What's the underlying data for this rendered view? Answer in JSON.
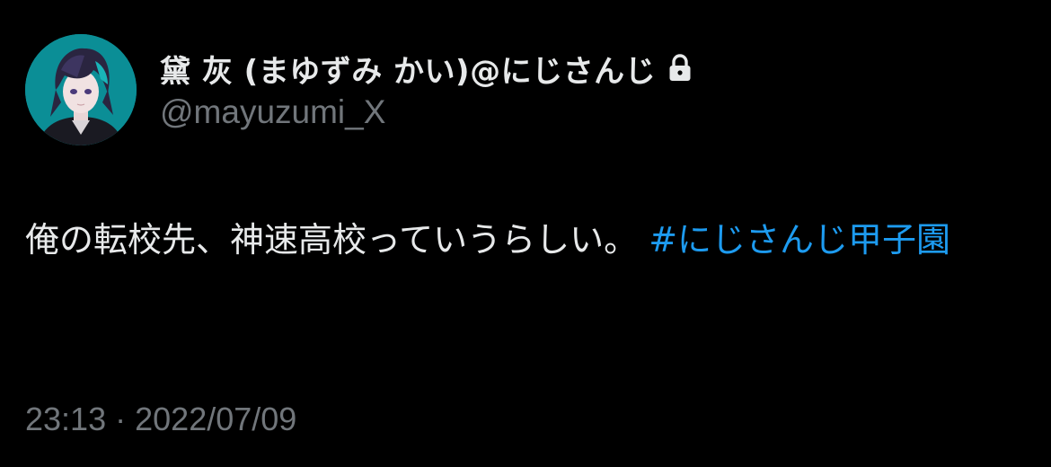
{
  "user": {
    "display_name": "黛 灰 (まゆずみ かい)@にじさんじ",
    "handle": "@mayuzumi_X",
    "protected_icon": "lock-icon",
    "avatar_icon": "avatar-image"
  },
  "tweet": {
    "text": "俺の転校先、神速高校っていうらしい。",
    "hashtag": "#にじさんじ甲子園",
    "time": "23:13",
    "separator": "·",
    "date": "2022/07/09"
  },
  "colors": {
    "background": "#000000",
    "text": "#e7e9ea",
    "secondary_text": "#71767b",
    "link": "#1d9bf0"
  }
}
